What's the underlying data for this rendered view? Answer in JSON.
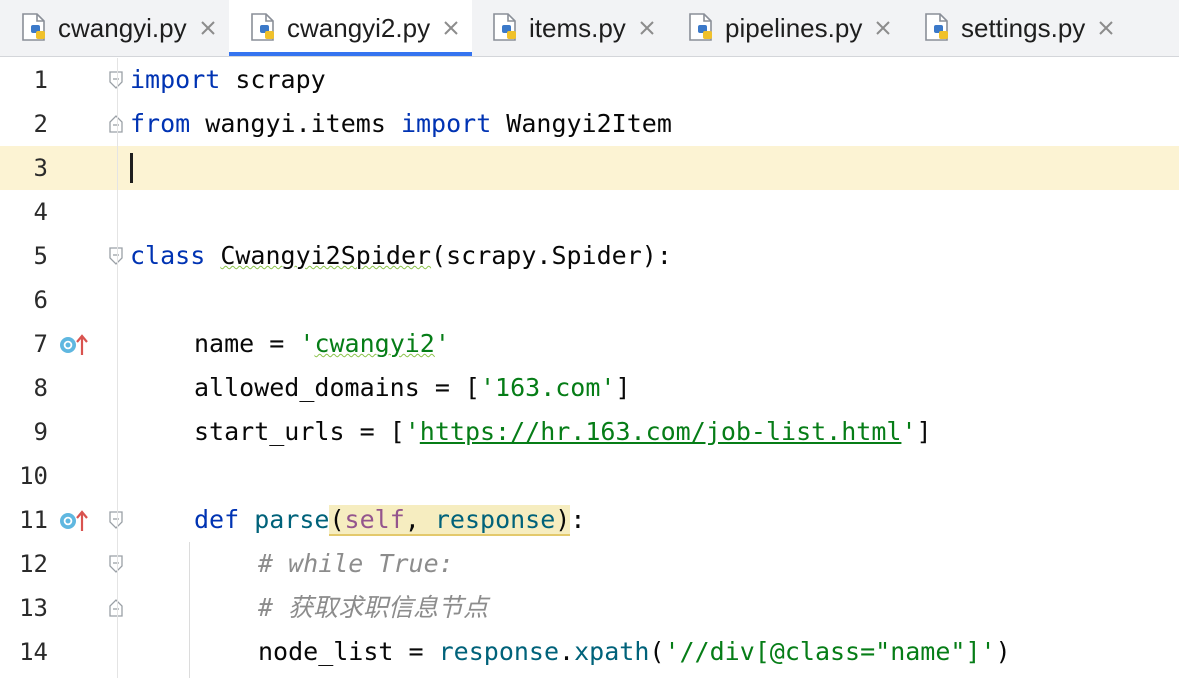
{
  "tabs": [
    {
      "label": "cwangyi.py",
      "active": false
    },
    {
      "label": "cwangyi2.py",
      "active": true
    },
    {
      "label": "items.py",
      "active": false
    },
    {
      "label": "pipelines.py",
      "active": false
    },
    {
      "label": "settings.py",
      "active": false
    }
  ],
  "colors": {
    "keyword": "#0033b3",
    "keyword_alt": "#871094",
    "string": "#067d17",
    "comment": "#8c8c8c",
    "function": "#00627a",
    "caret_line": "#fcf3d3",
    "active_tab_underline": "#3574f0"
  },
  "icons": {
    "tab_file": "python-file-icon",
    "tab_close": "close-icon",
    "gutter_override": "overrides-method-icon",
    "fold": "fold-marker-icon"
  },
  "editor": {
    "caret_line_number": 3,
    "line_numbers": [
      "1",
      "2",
      "3",
      "4",
      "5",
      "6",
      "7",
      "8",
      "9",
      "10",
      "11",
      "12",
      "13",
      "14"
    ],
    "code": {
      "l1": {
        "kw": "import",
        "rest": " scrapy"
      },
      "l2": {
        "kw1": "from",
        "mod": " wangyi.items ",
        "kw2": "import",
        "name": " Wangyi2Item"
      },
      "l5": {
        "kw": "class",
        "sp": " ",
        "cls": "Cwangyi2Spider",
        "base": "(scrapy.Spider):"
      },
      "l7": {
        "var": "name",
        "op": " = ",
        "q1": "'",
        "val": "cwangyi2",
        "q2": "'"
      },
      "l8": {
        "var": "allowed_domains",
        "op": " = [",
        "val": "'163.com'",
        "end": "]"
      },
      "l9": {
        "var": "start_urls",
        "op": " = [",
        "q1": "'",
        "url": "https://hr.163.com/job-list.html",
        "q2": "'",
        "end": "]"
      },
      "l11": {
        "kw": "def",
        "sp": " ",
        "fn": "parse",
        "open": "(",
        "self": "self",
        "comma": ", ",
        "param": "response",
        "close": ")",
        "colon": ":"
      },
      "l12": {
        "comment": "# while True:"
      },
      "l13": {
        "comment": "# 获取求职信息节点"
      },
      "l14": {
        "var": "node_list",
        "op": " = ",
        "obj": "response",
        "dot": ".",
        "method": "xpath",
        "open": "(",
        "arg": "'//div[@class=\"name\"]'",
        "close": ")"
      }
    }
  }
}
